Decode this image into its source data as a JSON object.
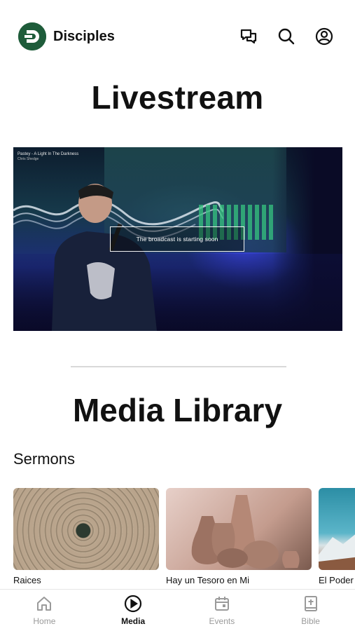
{
  "header": {
    "brand": "Disciples",
    "logo_color": "#1e5c3a",
    "icons": [
      "chat-icon",
      "search-icon",
      "account-icon"
    ]
  },
  "livestream": {
    "title": "Livestream",
    "video_title": "Pastey - A Light In The Darkness",
    "video_subtitle": "Chris Shedge",
    "notice": "The broadcast is starting soon"
  },
  "media_library": {
    "title": "Media Library",
    "rows": [
      {
        "title": "Sermons",
        "items": [
          {
            "label": "Raices"
          },
          {
            "label": "Hay un Tesoro en Mi"
          },
          {
            "label": "El Poder"
          }
        ]
      }
    ]
  },
  "tabbar": {
    "tabs": [
      {
        "label": "Home",
        "icon": "home-icon",
        "active": false
      },
      {
        "label": "Media",
        "icon": "play-circle-icon",
        "active": true
      },
      {
        "label": "Events",
        "icon": "calendar-icon",
        "active": false
      },
      {
        "label": "Bible",
        "icon": "bible-icon",
        "active": false
      }
    ],
    "active_color": "#111111",
    "inactive_color": "#9a9a9a"
  }
}
